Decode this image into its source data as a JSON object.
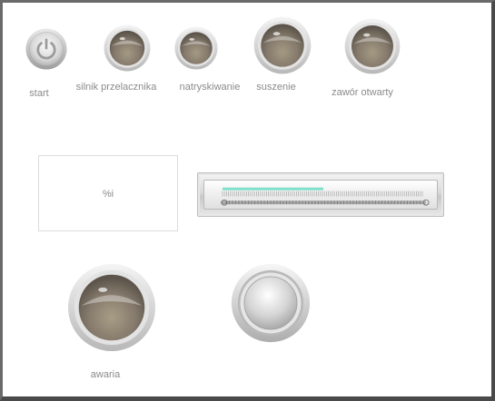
{
  "indicators": {
    "start": "start",
    "silnik": "silnik przelacznika",
    "natryskiwanie": "natryskiwanie",
    "suszenie": "suszenie",
    "zawor": "zawór otwarty",
    "awaria": "awaria"
  },
  "display": {
    "value_text": "%i"
  },
  "progress": {
    "level_percent": 50
  },
  "colors": {
    "lamp_off": "#857a6c",
    "bezel": "#cfcfcf",
    "progress_fill": "#7de0c9"
  }
}
